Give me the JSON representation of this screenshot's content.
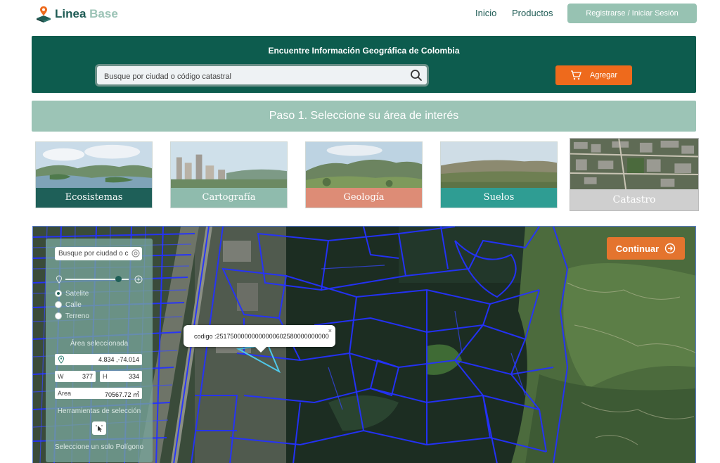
{
  "header": {
    "brand_part1": "Linea",
    "brand_part2": "Base",
    "nav": [
      "Inicio",
      "Productos"
    ],
    "register_label": "Registrarse / Iniciar Sesión"
  },
  "search_band": {
    "title": "Encuentre Información Geográfica de Colombia",
    "placeholder": "Busque por ciudad o código catastral",
    "add_label": "Agregar"
  },
  "step": {
    "label": "Paso 1. Seleccione su área de interés"
  },
  "cards": [
    {
      "label": "Ecosistemas"
    },
    {
      "label": "Cartografía"
    },
    {
      "label": "Geología"
    },
    {
      "label": "Suelos"
    },
    {
      "label": "Catastro"
    }
  ],
  "map": {
    "continue_label": "Continuar",
    "panel": {
      "search_placeholder": "Busque por ciudad o código catastral",
      "layers": [
        "Satelite",
        "Calle",
        "Terreno"
      ],
      "selected_layer": "Satelite",
      "area_title": "Área seleccionada",
      "coords": "4.834 ,-74.014",
      "width_label": "W",
      "width_value": "377",
      "height_label": "H",
      "height_value": "334",
      "area_label": "Area",
      "area_value": "70567.72 ㎡",
      "tools_title": "Herramientas de selección",
      "tool_note": "Seleccione un solo Polígono"
    },
    "popup": {
      "text": "codigo :25175000000000000602580000000000",
      "close": "×"
    }
  },
  "colors": {
    "brand_dark": "#0d5c4e",
    "brand_light": "#9cc4b6",
    "accent_orange": "#ee6a1c",
    "parcel_lines": "#2431ff"
  }
}
